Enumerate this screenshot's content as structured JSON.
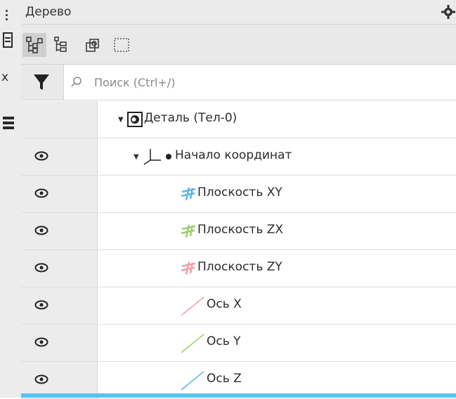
{
  "panel": {
    "title": "Дерево"
  },
  "search": {
    "placeholder": "Поиск (Ctrl+/)",
    "value": ""
  },
  "left_strip": {
    "label": "x"
  },
  "tree": {
    "root": {
      "label": "Деталь (Тел-0)"
    },
    "origin": {
      "label": "Начало координат"
    },
    "items": [
      {
        "label": "Плоскость XY",
        "icon": "plane-xy-icon",
        "color": "#5bb8e8"
      },
      {
        "label": "Плоскость ZX",
        "icon": "plane-zx-icon",
        "color": "#9ccf6f"
      },
      {
        "label": "Плоскость ZY",
        "icon": "plane-zy-icon",
        "color": "#f2a0a8"
      },
      {
        "label": "Ось X",
        "icon": "axis-x-icon",
        "color": "#f2a0a8"
      },
      {
        "label": "Ось Y",
        "icon": "axis-y-icon",
        "color": "#9ccf6f"
      },
      {
        "label": "Ось Z",
        "icon": "axis-z-icon",
        "color": "#5bb8e8"
      }
    ]
  },
  "colors": {
    "selection": "#56c4f0",
    "panel_bg": "#ebebeb"
  }
}
